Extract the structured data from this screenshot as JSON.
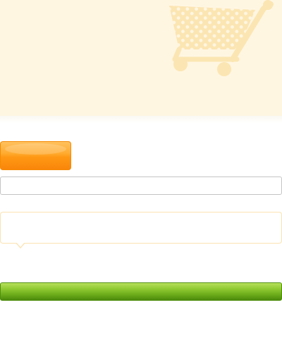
{
  "hero": {
    "background": "#fff6e2",
    "icon": "shopping-cart-icon",
    "icon_color": "#fbe5b2"
  },
  "orange_button": {
    "label": "",
    "color": "#ff9814"
  },
  "input": {
    "value": "",
    "placeholder": ""
  },
  "callout": {
    "text": "",
    "border_color": "#fbe3b3"
  },
  "green_button": {
    "label": "",
    "color": "#6fae1c"
  }
}
